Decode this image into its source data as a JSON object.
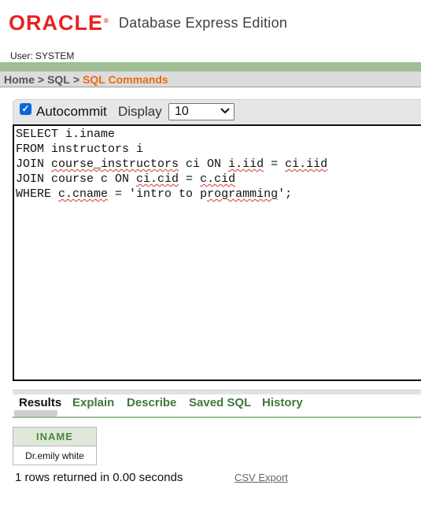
{
  "header": {
    "logo_text": "ORACLE",
    "logo_mark": "®",
    "product": "Database Express Edition",
    "user_label": "User: SYSTEM"
  },
  "breadcrumb": {
    "items": [
      "Home",
      "SQL",
      "SQL Commands"
    ],
    "separator": ">"
  },
  "options": {
    "autocommit_label": "Autocommit",
    "autocommit_checked": true,
    "display_label": "Display",
    "display_value": "10"
  },
  "editor": {
    "lines": [
      "SELECT i.iname",
      "FROM instructors i",
      "JOIN course_instructors ci ON i.iid = ci.iid",
      "JOIN course c ON ci.cid = c.cid",
      "WHERE c.cname = 'intro to programming';"
    ]
  },
  "tabs": [
    {
      "label": "Results",
      "active": true
    },
    {
      "label": "Explain",
      "active": false
    },
    {
      "label": "Describe",
      "active": false
    },
    {
      "label": "Saved SQL",
      "active": false
    },
    {
      "label": "History",
      "active": false
    }
  ],
  "results": {
    "columns": [
      "INAME"
    ],
    "rows": [
      [
        "Dr.emily white"
      ]
    ],
    "summary": "1 rows returned in 0.00 seconds",
    "export_label": "CSV Export"
  },
  "colors": {
    "oracle_red": "#e8231f",
    "breadcrumb_current": "#ea6a12",
    "tab_green": "#3d7a3a",
    "stripe_green": "#9fbe93"
  },
  "icons": {
    "checkbox": "checkbox-checked-icon",
    "select": "chevron-down-icon"
  }
}
